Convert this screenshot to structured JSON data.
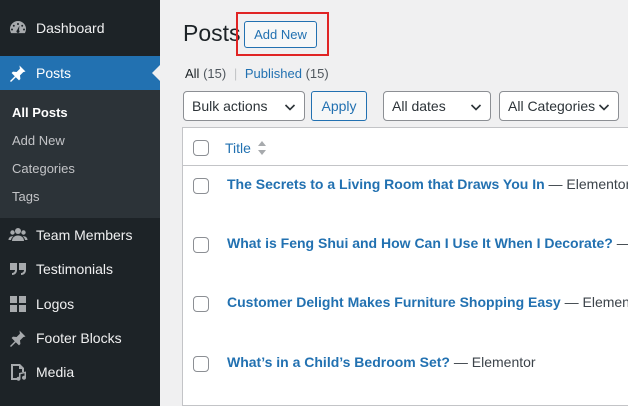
{
  "sidebar": {
    "items": [
      {
        "label": "Dashboard",
        "icon": "dashboard-icon"
      },
      {
        "label": "Posts",
        "icon": "pin-icon"
      },
      {
        "label": "Team Members",
        "icon": "users-icon"
      },
      {
        "label": "Testimonials",
        "icon": "quote-icon"
      },
      {
        "label": "Logos",
        "icon": "grid-icon"
      },
      {
        "label": "Footer Blocks",
        "icon": "pin-icon"
      },
      {
        "label": "Media",
        "icon": "media-icon"
      }
    ],
    "submenu": [
      "All Posts",
      "Add New",
      "Categories",
      "Tags"
    ]
  },
  "header": {
    "title": "Posts",
    "add_new_label": "Add New"
  },
  "filters": {
    "all_label": "All",
    "all_count": "(15)",
    "published_label": "Published",
    "published_count": "(15)",
    "separator": "|",
    "bulk_actions": "Bulk actions",
    "apply_label": "Apply",
    "dates": "All dates",
    "categories": "All Categories"
  },
  "table": {
    "title_header": "Title",
    "rows": [
      {
        "title": "The Secrets to a Living Room that Draws You In",
        "author": " — Elementor"
      },
      {
        "title": "What is Feng Shui and How Can I Use It When I Decorate?",
        "author": " —"
      },
      {
        "title": "Customer Delight Makes Furniture Shopping Easy",
        "author": " — Elementor"
      },
      {
        "title": "What’s in a Child’s Bedroom Set?",
        "author": " — Elementor"
      }
    ]
  },
  "colors": {
    "sidebar_bg": "#1d2327",
    "submenu_bg": "#2c3338",
    "accent": "#2271b1",
    "highlight": "#e02424"
  }
}
